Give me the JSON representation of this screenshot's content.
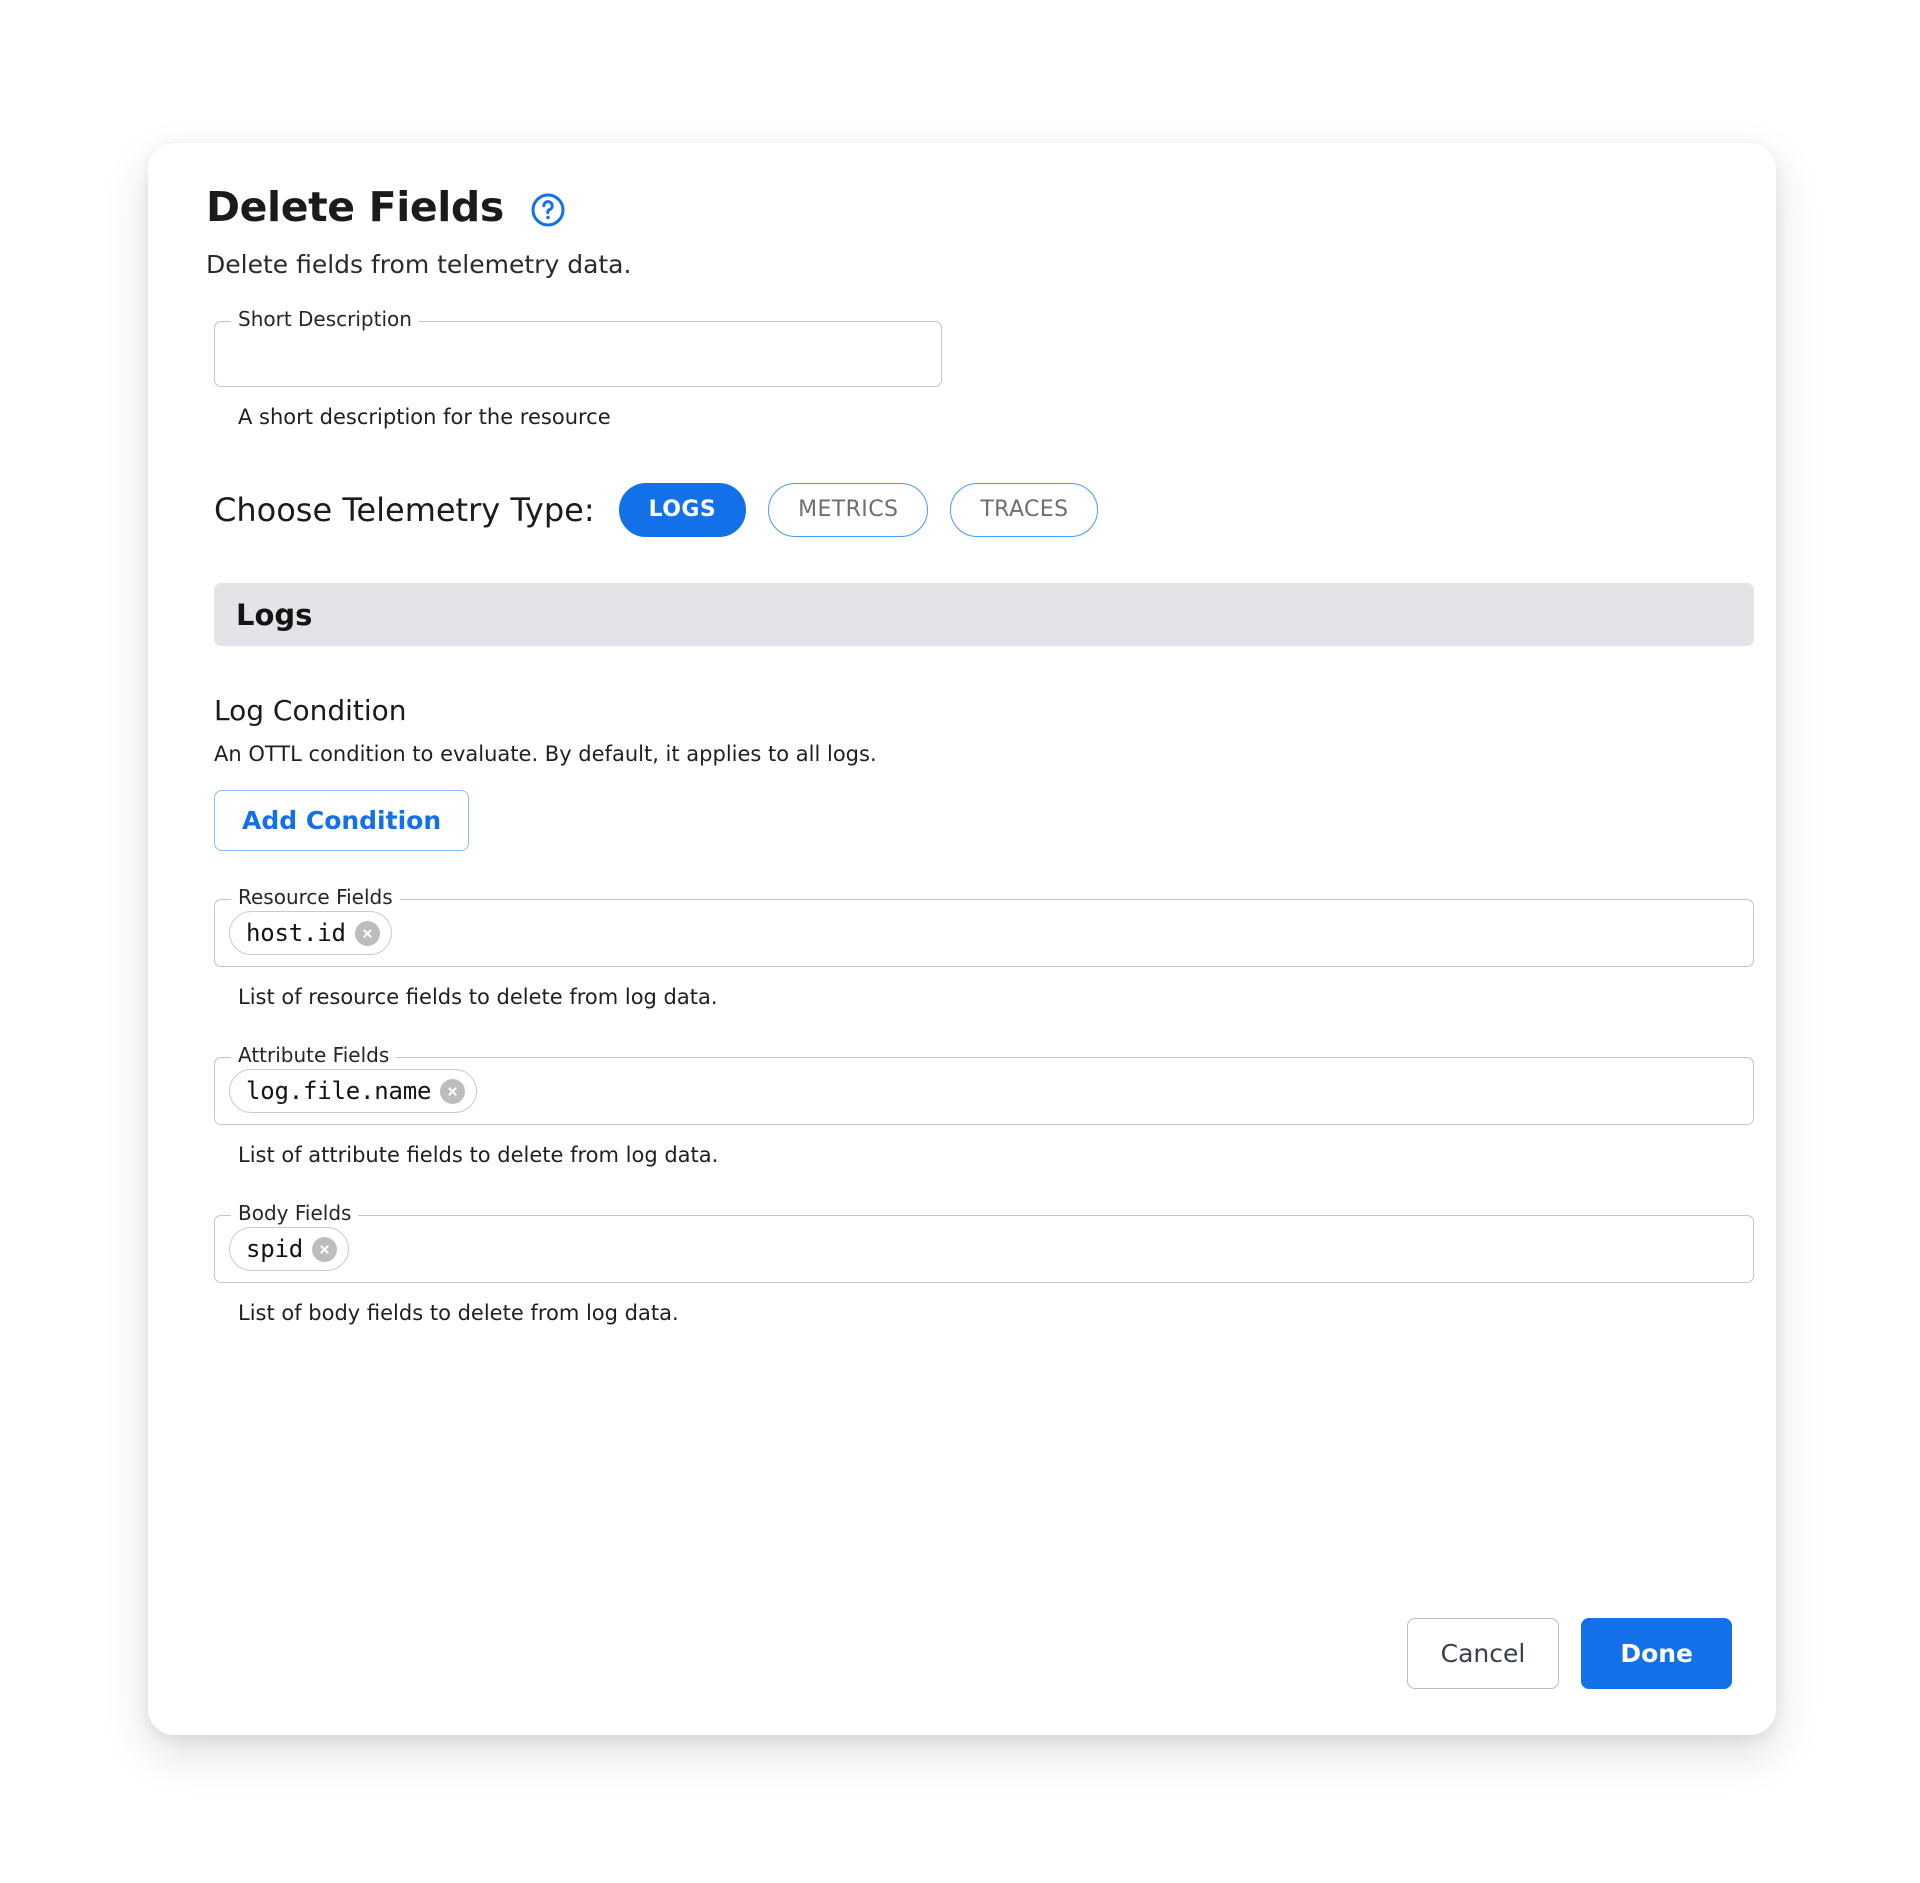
{
  "dialog": {
    "title": "Delete Fields",
    "help_icon": "help-circle-icon",
    "subtitle": "Delete fields from telemetry data."
  },
  "short_description": {
    "legend": "Short Description",
    "value": "",
    "placeholder": "",
    "helper": "A short description for the resource"
  },
  "telemetry": {
    "label": "Choose Telemetry Type:",
    "options": [
      {
        "label": "LOGS",
        "selected": true
      },
      {
        "label": "METRICS",
        "selected": false
      },
      {
        "label": "TRACES",
        "selected": false
      }
    ]
  },
  "section": {
    "title": "Logs"
  },
  "log_condition": {
    "title": "Log Condition",
    "description": "An OTTL condition to evaluate. By default, it applies to all logs.",
    "add_button": "Add Condition"
  },
  "fields": [
    {
      "legend": "Resource Fields",
      "chips": [
        "host.id"
      ],
      "helper": "List of resource fields to delete from log data."
    },
    {
      "legend": "Attribute Fields",
      "chips": [
        "log.file.name"
      ],
      "helper": "List of attribute fields to delete from log data."
    },
    {
      "legend": "Body Fields",
      "chips": [
        "spid"
      ],
      "helper": "List of body fields to delete from log data."
    }
  ],
  "footer": {
    "cancel_label": "Cancel",
    "done_label": "Done"
  },
  "colors": {
    "accent_blue": "#1271e8",
    "section_bar": "#e3e4e8",
    "chip_close": "#bdbdbd",
    "border_gray": "#c4c4c4"
  }
}
